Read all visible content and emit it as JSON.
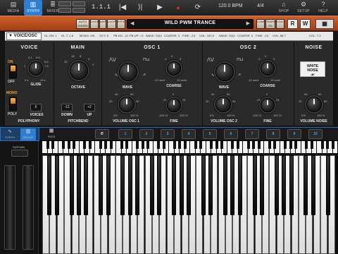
{
  "toolbar": {
    "nav": [
      {
        "label": "MEDIA",
        "icon": "media-icon"
      },
      {
        "label": "SYNTH",
        "icon": "synth-icon",
        "active": true
      },
      {
        "label": "MIXER",
        "icon": "mixer-icon"
      }
    ],
    "right_nav": [
      {
        "label": "SHOP",
        "icon": "shop-icon"
      },
      {
        "label": "SETUP",
        "icon": "setup-icon"
      },
      {
        "label": "HELP",
        "icon": "help-icon"
      }
    ],
    "position": "1.1.1",
    "tempo": "120.0 BPM",
    "signature": "4/4",
    "transport_glyphs": {
      "rewind": "|◀",
      "prev": "⟩|",
      "play": "▶",
      "record": "●",
      "loop": "⟳"
    }
  },
  "header": {
    "buttons": [
      "AUTO CHORD",
      "CHORD",
      "ARP",
      "LOOP",
      "EFFECTS",
      "COMP",
      "TEMPO FX",
      "VOICE"
    ],
    "preset_name": "WILD PWM TRANCE",
    "rw": [
      "R",
      "W"
    ],
    "arrows": {
      "left": "◀",
      "right": "▶"
    }
  },
  "param_strip": {
    "voice_select": "VOICE/OSC",
    "params": [
      "GL.ON: 1",
      "GL.T: 1.6",
      "MONO: ON",
      "OCT: 8",
      "PB.DO: -12",
      "PB.UP: +2",
      "WAVE: SQU",
      "COARSE: 0",
      "FINE: -24",
      "VOL: 100.0",
      "WAVE: SQU",
      "COARSE: 0",
      "FINE: -24",
      "VOL: 88.7",
      "VOL: 7.3"
    ]
  },
  "voice": {
    "title": "VOICE",
    "on": "ON",
    "off": "OFF",
    "mono": "MONO",
    "poly": "POLY",
    "glide_label": "GLIDE",
    "glide_scale": [
      "0.1",
      "0.5",
      "0.5",
      "1",
      "2.0",
      "5.0",
      "0 s",
      "10 s"
    ],
    "voices_value": "6",
    "voices_label": "VOICES",
    "polyphony_label": "POLYPHONY"
  },
  "main": {
    "title": "MAIN",
    "octave_label": "OCTAVE",
    "octave_scale": [
      "16'",
      "8'",
      "4'",
      "32'",
      "2'"
    ],
    "down_value": "-12",
    "down_label": "DOWN",
    "up_value": "+2",
    "up_label": "UP",
    "pitchbend_label": "PITCHBEND"
  },
  "osc1": {
    "title": "OSC 1",
    "wave_label": "WAVE",
    "coarse_label": "COARSE",
    "coarse_scale": [
      "-12 semi",
      "12 semi",
      "-3",
      "0",
      "3"
    ],
    "volume_label": "VOLUME OSC 1",
    "volume_scale": [
      "20",
      "40",
      "60",
      "80",
      "0%",
      "100 %"
    ],
    "fine_label": "FINE",
    "fine_scale": [
      "-24",
      "0",
      "24",
      "-100 Ct",
      "100 Ct"
    ]
  },
  "osc2": {
    "title": "OSC 2",
    "wave_label": "WAVE",
    "coarse_label": "COARSE",
    "coarse_scale": [
      "-12 semi",
      "12 semi",
      "-3",
      "0",
      "3"
    ],
    "volume_label": "VOLUME OSC 2",
    "volume_scale": [
      "20",
      "40",
      "60",
      "80",
      "0%",
      "100 %"
    ],
    "fine_label": "FINE",
    "fine_scale": [
      "-24",
      "0",
      "24",
      "-100 Ct",
      "100 Ct"
    ]
  },
  "noise": {
    "title": "NOISE",
    "button_line1": "WHITE",
    "button_line2": "NOISE",
    "volume_label": "VOLUME NOISE",
    "volume_scale": [
      "20",
      "40",
      "60",
      "80",
      "0%",
      "100 %"
    ]
  },
  "key_strip": {
    "buttons": [
      {
        "label": "SYNTH"
      },
      {
        "label": "DRUMS"
      },
      {
        "label": "PADS"
      }
    ],
    "octaves": [
      "e",
      "1",
      "2",
      "3",
      "4",
      "5",
      "6",
      "7",
      "8",
      "9",
      "10"
    ]
  },
  "mod_panel": {
    "sustain_label": "SUSTAIN"
  },
  "colors": {
    "accent": "#2c7fd2",
    "header": "#c4552a",
    "knob_led": "#f0a030"
  }
}
